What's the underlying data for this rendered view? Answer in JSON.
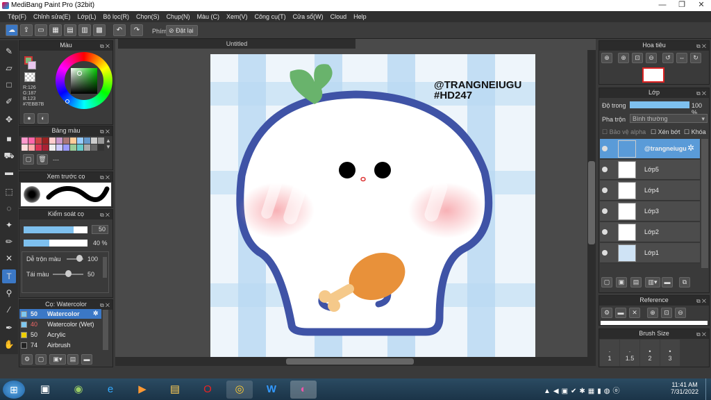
{
  "window": {
    "title": "MediBang Paint Pro (32bit)",
    "minimize": "—",
    "maximize": "❐",
    "close": "✕"
  },
  "menu": [
    "Tệp(F)",
    "Chỉnh sửa(E)",
    "Lớp(L)",
    "Bộ lọc(R)",
    "Chọn(S)",
    "Chụp(N)",
    "Màu (C)",
    "Xem(V)",
    "Công cụ(T)",
    "Cửa sổ(W)",
    "Cloud",
    "Help"
  ],
  "toolbar": {
    "shortcut_label": "Phím",
    "reset_label": "Đặt lại"
  },
  "color_panel": {
    "title": "Màu",
    "r": "R:126",
    "g": "G:187",
    "b": "B:123",
    "hex": "#7EBB7B"
  },
  "palette_panel": {
    "title": "Bảng màu",
    "entry": "---"
  },
  "preview_panel": {
    "title": "Xem trước cọ"
  },
  "brush_control": {
    "title": "Kiểm soát cọ",
    "size": "50",
    "opacity": "40",
    "opacity_unit": "%",
    "mix_label": "Dễ trộn màu",
    "mix_value": "100",
    "resample_label": "Tái màu",
    "resample_value": "50"
  },
  "brush_list": {
    "title": "Cọ: Watercolor",
    "items": [
      {
        "num": "50",
        "name": "Watercolor",
        "color": "#7ec8f0"
      },
      {
        "num": "40",
        "name": "Watercolor (Wet)",
        "color": "#7ec8f0"
      },
      {
        "num": "50",
        "name": "Acrylic",
        "color": "#f0d000"
      },
      {
        "num": "74",
        "name": "Airbrush",
        "color": "#222222"
      }
    ]
  },
  "document": {
    "tab": "Untitled"
  },
  "artwork": {
    "watermark_line1": "@TRANGNEIUGU",
    "watermark_line2": "#HD247"
  },
  "navigator": {
    "title": "Hoa tiêu"
  },
  "layer_panel": {
    "title": "Lớp",
    "opacity_label": "Độ trong",
    "opacity_value": "100 %",
    "blend_label": "Pha trộn",
    "blend_value": "Bình thường",
    "protect_alpha": "Bảo vệ alpha",
    "clip": "Xén bớt",
    "lock": "Khóa",
    "layers": [
      "@trangneiugu",
      "Lớp5",
      "Lớp4",
      "Lớp3",
      "Lớp2",
      "Lớp1"
    ]
  },
  "reference_panel": {
    "title": "Reference"
  },
  "brush_size_panel": {
    "title": "Brush Size",
    "sizes": [
      "1",
      "1.5",
      "2",
      "3"
    ]
  },
  "taskbar": {
    "time": "11:41 AM",
    "date": "7/31/2022"
  }
}
